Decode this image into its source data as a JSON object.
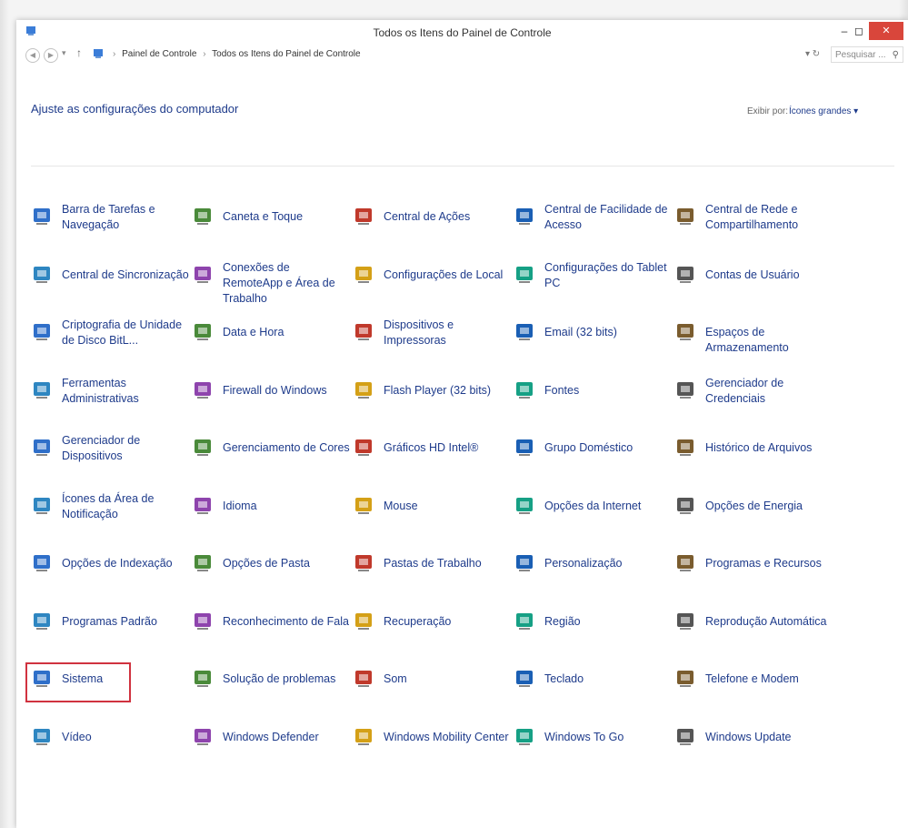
{
  "window": {
    "title": "Todos os Itens do Painel de Controle",
    "controls": {
      "minimize": "–",
      "maximize": "◻",
      "close": "✕"
    }
  },
  "address": {
    "breadcrumb": [
      "Painel de Controle",
      "Todos os Itens do Painel de Controle"
    ],
    "search_placeholder": "Pesquisar ..."
  },
  "header": {
    "title": "Ajuste as configurações do computador",
    "view_by_label": "Exibir por:",
    "view_by_value": "Ícones grandes ▾"
  },
  "items": [
    {
      "label": "Barra de Tarefas e Navegação",
      "icon": "taskbar-icon"
    },
    {
      "label": "Caneta e Toque",
      "icon": "pen-icon"
    },
    {
      "label": "Central de Ações",
      "icon": "flag-icon"
    },
    {
      "label": "Central de Facilidade de Acesso",
      "icon": "accessibility-icon"
    },
    {
      "label": "Central de Rede e Compartilhamento",
      "icon": "network-icon"
    },
    {
      "label": "Central de Sincronização",
      "icon": "sync-icon"
    },
    {
      "label": "Conexões de RemoteApp e Área de Trabalho",
      "icon": "remote-desktop-icon"
    },
    {
      "label": "Configurações de Local",
      "icon": "location-icon"
    },
    {
      "label": "Configurações do Tablet PC",
      "icon": "tablet-icon"
    },
    {
      "label": "Contas de Usuário",
      "icon": "user-accounts-icon"
    },
    {
      "label": "Criptografia de Unidade de Disco BitL...",
      "icon": "key-icon"
    },
    {
      "label": "Data e Hora",
      "icon": "clock-icon"
    },
    {
      "label": "Dispositivos e Impressoras",
      "icon": "printer-icon"
    },
    {
      "label": "Email (32 bits)",
      "icon": "email-icon"
    },
    {
      "label": "Espaços de Armazenamento",
      "icon": "storage-icon"
    },
    {
      "label": "Ferramentas Administrativas",
      "icon": "admin-tools-icon"
    },
    {
      "label": "Firewall do Windows",
      "icon": "firewall-icon"
    },
    {
      "label": "Flash Player (32 bits)",
      "icon": "flash-icon"
    },
    {
      "label": "Fontes",
      "icon": "fonts-icon"
    },
    {
      "label": "Gerenciador de Credenciais",
      "icon": "credentials-icon"
    },
    {
      "label": "Gerenciador de Dispositivos",
      "icon": "device-manager-icon"
    },
    {
      "label": "Gerenciamento de Cores",
      "icon": "color-icon"
    },
    {
      "label": "Gráficos HD Intel®",
      "icon": "intel-graphics-icon"
    },
    {
      "label": "Grupo Doméstico",
      "icon": "homegroup-icon"
    },
    {
      "label": "Histórico de Arquivos",
      "icon": "file-history-icon"
    },
    {
      "label": "Ícones da Área de Notificação",
      "icon": "notification-icon"
    },
    {
      "label": "Idioma",
      "icon": "language-icon"
    },
    {
      "label": "Mouse",
      "icon": "mouse-icon"
    },
    {
      "label": "Opções da Internet",
      "icon": "internet-icon"
    },
    {
      "label": "Opções de Energia",
      "icon": "power-icon"
    },
    {
      "label": "Opções de Indexação",
      "icon": "indexing-icon"
    },
    {
      "label": "Opções de Pasta",
      "icon": "folder-options-icon"
    },
    {
      "label": "Pastas de Trabalho",
      "icon": "work-folders-icon"
    },
    {
      "label": "Personalização",
      "icon": "personalization-icon"
    },
    {
      "label": "Programas e Recursos",
      "icon": "programs-icon"
    },
    {
      "label": "Programas Padrão",
      "icon": "default-programs-icon"
    },
    {
      "label": "Reconhecimento de Fala",
      "icon": "microphone-icon"
    },
    {
      "label": "Recuperação",
      "icon": "recovery-icon"
    },
    {
      "label": "Região",
      "icon": "region-icon"
    },
    {
      "label": "Reprodução Automática",
      "icon": "autoplay-icon"
    },
    {
      "label": "Sistema",
      "icon": "system-icon"
    },
    {
      "label": "Solução de problemas",
      "icon": "troubleshoot-icon"
    },
    {
      "label": "Som",
      "icon": "speaker-icon"
    },
    {
      "label": "Teclado",
      "icon": "keyboard-icon"
    },
    {
      "label": "Telefone e Modem",
      "icon": "phone-icon"
    },
    {
      "label": "Vídeo",
      "icon": "video-icon"
    },
    {
      "label": "Windows Defender",
      "icon": "defender-icon"
    },
    {
      "label": "Windows Mobility Center",
      "icon": "mobility-icon"
    },
    {
      "label": "Windows To Go",
      "icon": "windows-to-go-icon"
    },
    {
      "label": "Windows Update",
      "icon": "windows-update-icon"
    }
  ],
  "highlighted_item": "Sistema"
}
